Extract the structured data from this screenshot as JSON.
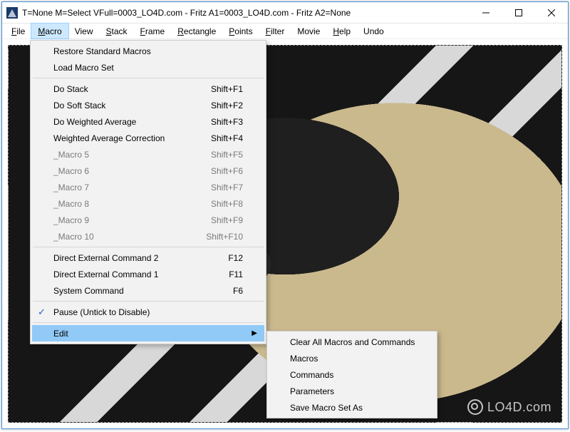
{
  "title": "T=None M=Select VFull=0003_LO4D.com - Fritz A1=0003_LO4D.com - Fritz A2=None",
  "menubar": [
    {
      "label": "File",
      "accel": "F"
    },
    {
      "label": "Macro",
      "accel": "M",
      "active": true
    },
    {
      "label": "View",
      "accel": ""
    },
    {
      "label": "Stack",
      "accel": "S"
    },
    {
      "label": "Frame",
      "accel": "F"
    },
    {
      "label": "Rectangle",
      "accel": "R"
    },
    {
      "label": "Points",
      "accel": "P"
    },
    {
      "label": "Filter",
      "accel": "F"
    },
    {
      "label": "Movie",
      "accel": ""
    },
    {
      "label": "Help",
      "accel": "H"
    },
    {
      "label": "Undo",
      "accel": ""
    }
  ],
  "macroMenu": {
    "group1": [
      {
        "label": "Restore Standard Macros"
      },
      {
        "label": "Load Macro Set"
      }
    ],
    "group2": [
      {
        "label": "Do Stack",
        "shortcut": "Shift+F1"
      },
      {
        "label": "Do Soft Stack",
        "shortcut": "Shift+F2"
      },
      {
        "label": "Do Weighted Average",
        "shortcut": "Shift+F3"
      },
      {
        "label": "Weighted Average Correction",
        "shortcut": "Shift+F4"
      },
      {
        "label": "_Macro 5",
        "shortcut": "Shift+F5",
        "disabled": true
      },
      {
        "label": "_Macro 6",
        "shortcut": "Shift+F6",
        "disabled": true
      },
      {
        "label": "_Macro 7",
        "shortcut": "Shift+F7",
        "disabled": true
      },
      {
        "label": "_Macro 8",
        "shortcut": "Shift+F8",
        "disabled": true
      },
      {
        "label": "_Macro 9",
        "shortcut": "Shift+F9",
        "disabled": true
      },
      {
        "label": "_Macro 10",
        "shortcut": "Shift+F10",
        "disabled": true
      }
    ],
    "group3": [
      {
        "label": "Direct External Command 2",
        "shortcut": "F12"
      },
      {
        "label": "Direct External Command 1",
        "shortcut": "F11"
      },
      {
        "label": "System Command",
        "shortcut": "F6"
      }
    ],
    "pause": {
      "label": "Pause (Untick to Disable)",
      "checked": true
    },
    "edit": {
      "label": "Edit",
      "submenu": true,
      "highlight": true
    }
  },
  "editSubmenu": [
    {
      "label": "Clear All Macros and Commands"
    },
    {
      "label": "Macros"
    },
    {
      "label": "Commands"
    },
    {
      "label": "Parameters"
    },
    {
      "label": "Save Macro Set As"
    }
  ],
  "watermark": "LO4D.com"
}
